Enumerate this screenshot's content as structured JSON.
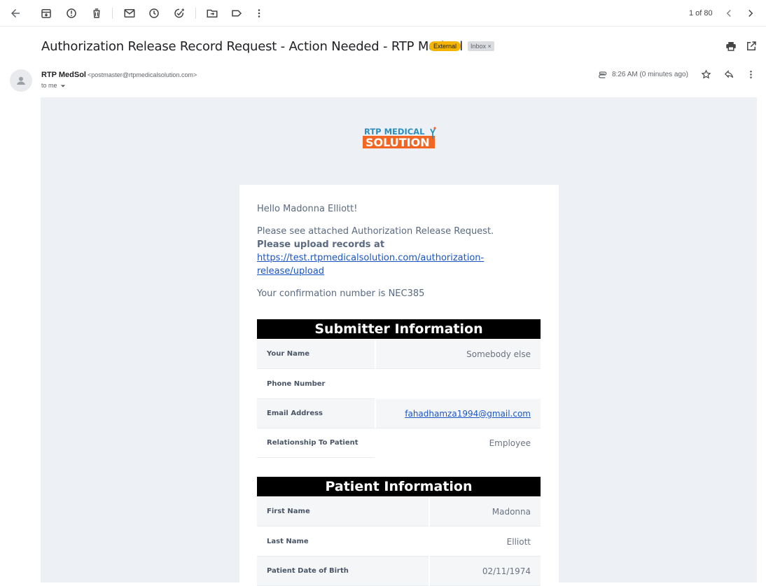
{
  "toolbar": {
    "icons": [
      "back-arrow-icon",
      "archive-icon",
      "report-spam-icon",
      "delete-icon",
      "mark-unread-icon",
      "snooze-icon",
      "add-task-icon",
      "move-to-icon",
      "label-icon",
      "more-icon"
    ],
    "pager": "1 of 80"
  },
  "email": {
    "subject": "Authorization Release Record Request - Action Needed - RTP MedSol",
    "badge_external": "External",
    "badge_inbox": "Inbox",
    "badge_inbox_close": "×",
    "sender_name": "RTP MedSol",
    "sender_email": "<postmaster@rtpmedicalsolution.com>",
    "recipient": "to me",
    "time": "8:26 AM (0 minutes ago)"
  },
  "body": {
    "logo_line1": "RTP MEDICAL",
    "logo_line2": "SOLUTION",
    "greeting": "Hello Madonna Elliott!",
    "line1": "Please see attached Authorization Release Request.",
    "line2_bold": "Please upload records at",
    "link_line1": "https://test.rtpmedicalsolution.com/authorization-",
    "link_line2": "release/upload",
    "confirmation": "Your confirmation number is NEC385",
    "submitter": {
      "title": "Submitter Information",
      "rows": [
        {
          "label": "Your Name",
          "value": "Somebody else"
        },
        {
          "label": "Phone Number",
          "value": ""
        },
        {
          "label": "Email Address",
          "value": "fahadhamza1994@gmail.com"
        },
        {
          "label": "Relationship To Patient",
          "value": "Employee"
        }
      ]
    },
    "patient": {
      "title": "Patient Information",
      "rows": [
        {
          "label": "First Name",
          "value": "Madonna"
        },
        {
          "label": "Last Name",
          "value": "Elliott"
        },
        {
          "label": "Patient Date of Birth",
          "value": "02/11/1974"
        }
      ]
    }
  }
}
